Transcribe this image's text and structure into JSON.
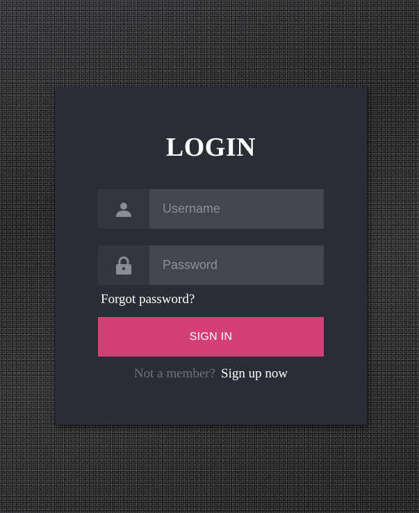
{
  "login": {
    "title": "LOGIN",
    "username": {
      "placeholder": "Username",
      "value": "",
      "icon": "user-icon"
    },
    "password": {
      "placeholder": "Password",
      "value": "",
      "icon": "lock-icon"
    },
    "forgot_label": "Forgot password?",
    "signin_label": "SIGN IN",
    "footer": {
      "prompt": "Not a member?",
      "signup_label": "Sign up now"
    }
  },
  "colors": {
    "card_bg": "#2a2e34",
    "icon_box_bg": "#32373e",
    "input_bg": "#42474f",
    "accent": "#d43f76",
    "text": "#ffffff",
    "muted": "#6e7278",
    "icon": "#8a8d93"
  }
}
